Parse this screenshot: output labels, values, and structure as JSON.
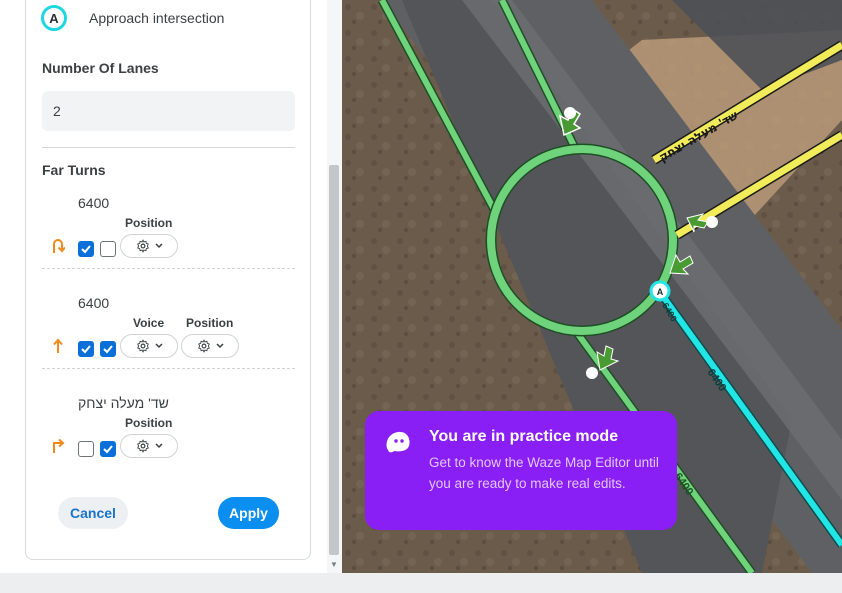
{
  "panel": {
    "approach": {
      "badge": "A",
      "label": "Approach intersection"
    },
    "lanes": {
      "title": "Number Of Lanes",
      "value": "2"
    },
    "far_turns": {
      "title": "Far Turns",
      "turns": [
        {
          "name": "6400",
          "direction_icon": "u-turn-icon",
          "voice_label": "",
          "position_label": "Position",
          "checkbox1": true,
          "checkbox2": false
        },
        {
          "name": "6400",
          "direction_icon": "straight-arrow-icon",
          "voice_label": "Voice",
          "position_label": "Position",
          "checkbox1": true,
          "checkbox2": true
        },
        {
          "name": "שד' מעלה יצחק",
          "direction_icon": "turn-right-icon",
          "voice_label": "",
          "position_label": "Position",
          "checkbox1": false,
          "checkbox2": true
        }
      ]
    },
    "cancel_label": "Cancel",
    "apply_label": "Apply"
  },
  "map": {
    "road_labels": {
      "yellow_road": "שד' מעלה יצחק",
      "cyan_road": "6400",
      "green_road": "6400",
      "small_cyan": "6400"
    },
    "node_badge": "A"
  },
  "practice_banner": {
    "title": "You are in practice mode",
    "body": "Get to know the Waze Map Editor until you are ready to make real edits."
  },
  "colors": {
    "accent": "#0a8ef0",
    "checkbox": "#0a6fd8",
    "turn_icon": "#f08a1c",
    "banner": "#8a1ff5",
    "road_green": "#6fd37b",
    "road_yellow": "#f2ec5a",
    "road_cyan": "#22e6e6"
  }
}
